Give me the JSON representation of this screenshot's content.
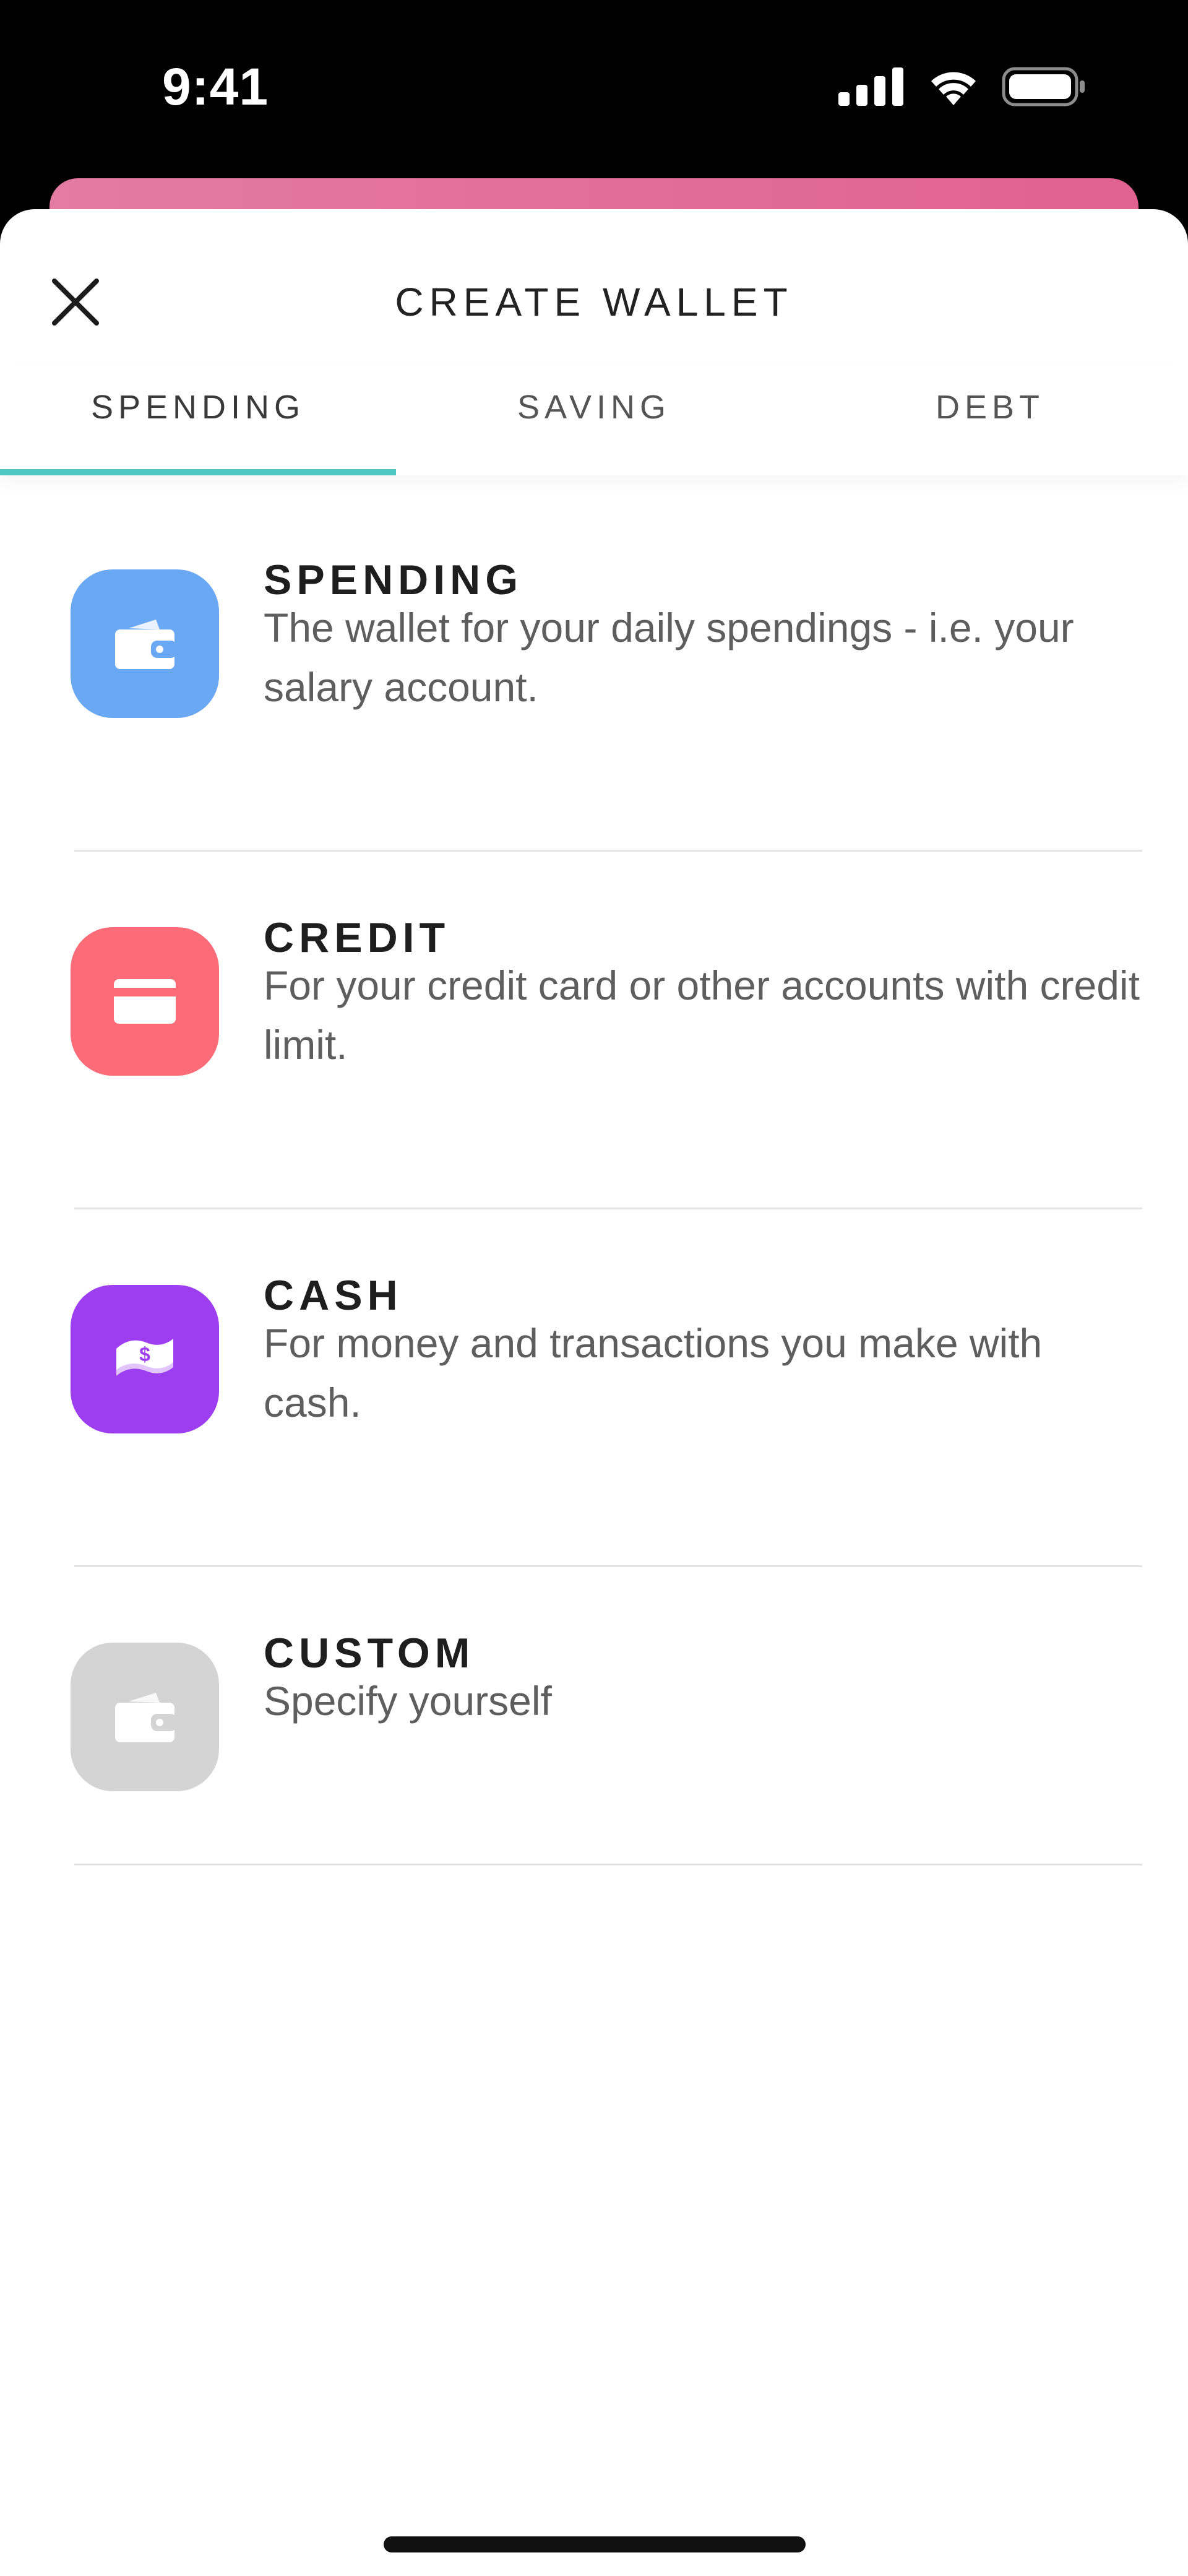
{
  "status_bar": {
    "time": "9:41"
  },
  "sheet": {
    "title": "CREATE WALLET",
    "close_icon": "close-icon"
  },
  "tabs": [
    {
      "label": "SPENDING",
      "active": true
    },
    {
      "label": "SAVING",
      "active": false
    },
    {
      "label": "DEBT",
      "active": false
    }
  ],
  "wallet_types": [
    {
      "title": "SPENDING",
      "description": "The wallet for your daily spendings - i.e. your salary account.",
      "icon": "wallet-icon",
      "color": "#6aa8f4"
    },
    {
      "title": "CREDIT",
      "description": "For your credit card or other accounts with credit limit.",
      "icon": "credit-card-icon",
      "color": "#fb6b78"
    },
    {
      "title": "CASH",
      "description": "For money and transactions you make with cash.",
      "icon": "cash-icon",
      "color": "#9d3ef0"
    },
    {
      "title": "CUSTOM",
      "description": "Specify yourself",
      "icon": "wallet-icon",
      "color": "#d4d4d4"
    }
  ],
  "colors": {
    "tab_indicator": "#4fc7c3",
    "behind_card": "#e0628f"
  }
}
